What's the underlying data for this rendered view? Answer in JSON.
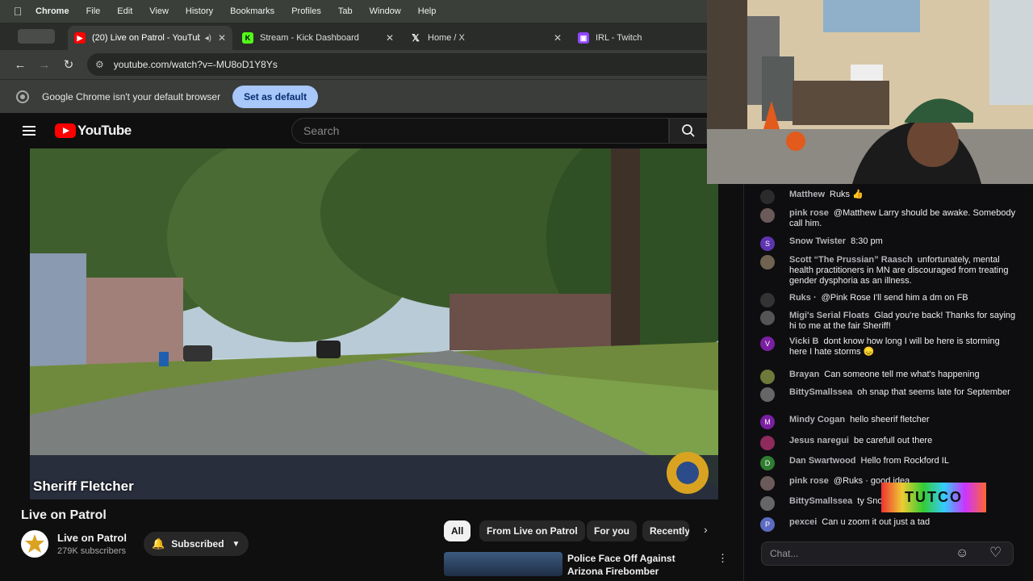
{
  "menubar": {
    "app": "Chrome",
    "items": [
      "File",
      "Edit",
      "View",
      "History",
      "Bookmarks",
      "Profiles",
      "Tab",
      "Window",
      "Help"
    ]
  },
  "tabs": [
    {
      "label": "(20) Live on Patrol - YouTube",
      "icon": "youtube-icon",
      "active": true
    },
    {
      "label": "Stream - Kick Dashboard",
      "icon": "kick-icon"
    },
    {
      "label": "Home / X",
      "icon": "x-icon"
    },
    {
      "label": "IRL - Twitch",
      "icon": "twitch-icon"
    }
  ],
  "toolbar": {
    "url": "youtube.com/watch?v=-MU8oD1Y8Ys"
  },
  "infobar": {
    "message": "Google Chrome isn't your default browser",
    "button": "Set as default"
  },
  "youtube": {
    "logo": "YouTube",
    "search_placeholder": "Search",
    "video_overlay": "Sheriff Fletcher",
    "title": "Live on Patrol",
    "channel": "Live on Patrol",
    "subscribers": "279K subscribers",
    "subscribe_label": "Subscribed",
    "chips": [
      "All",
      "From Live on Patrol",
      "For you",
      "Recently"
    ],
    "rec_title": "Police Face Off Against Arizona Firebomber"
  },
  "chat": {
    "messages": [
      {
        "user": "Matthew",
        "text": "Ruks 👍",
        "avatar_color": "#2b2b2b",
        "initial": ""
      },
      {
        "user": "pink rose",
        "text": "@Matthew Larry should be awake. Somebody call him.",
        "avatar_color": "#6b5a5a",
        "initial": ""
      },
      {
        "user": "Snow Twister",
        "text": "8:30 pm",
        "avatar_color": "#5e35b1",
        "initial": "S"
      },
      {
        "user": "Scott “The Prussian” Raasch",
        "text": "unfortunately, mental health practitioners in MN are discouraged from treating gender dysphoria as an illness.",
        "avatar_color": "#6f6250",
        "initial": ""
      },
      {
        "user": "Ruks ·",
        "text": "@Pink Rose I'll send him a dm on FB",
        "avatar_color": "#333",
        "initial": ""
      },
      {
        "user": "Migi's Serial Floats",
        "text": "Glad you're back! Thanks for saying hi to me at the fair Sheriff!",
        "avatar_color": "#555",
        "initial": ""
      },
      {
        "user": "Vicki B",
        "text": "dont know how long I will be here is storming here I hate storms 😞",
        "avatar_color": "#7b1fa2",
        "initial": "V"
      },
      {
        "user": "Brayan",
        "text": "Can someone tell me what's happening",
        "avatar_color": "#6d7a3a",
        "initial": ""
      },
      {
        "user": "BittySmallssea",
        "text": "oh snap that seems late for September",
        "avatar_color": "#666",
        "initial": ""
      },
      {
        "user": "Mindy Cogan",
        "text": "hello sheerif fletcher",
        "avatar_color": "#7b1fa2",
        "initial": "M"
      },
      {
        "user": "Jesus naregui",
        "text": "be carefull out there",
        "avatar_color": "#8e2a5c",
        "initial": ""
      },
      {
        "user": "Dan Swartwood",
        "text": "Hello from Rockford IL",
        "avatar_color": "#2e7d32",
        "initial": "D"
      },
      {
        "user": "pink rose",
        "text": "@Ruks · good idea",
        "avatar_color": "#6b5a5a",
        "initial": ""
      },
      {
        "user": "BittySmallssea",
        "text": "ty Sno",
        "avatar_color": "#666",
        "initial": ""
      },
      {
        "user": "pexcei",
        "text": "Can u zoom it out just a tad",
        "avatar_color": "#5c6bc0",
        "initial": "P"
      }
    ],
    "input_placeholder": "Chat...",
    "overlay_badge": "TUTCO"
  }
}
